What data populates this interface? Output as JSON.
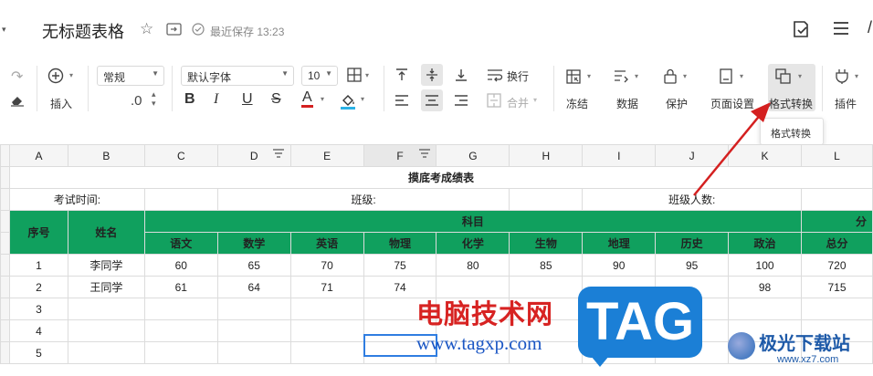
{
  "titlebar": {
    "doc_title": "无标题表格",
    "save_status": "最近保存 13:23"
  },
  "toolbar": {
    "insert_label": "插入",
    "format_style": "常规",
    "decimal_label": ".0",
    "font_name": "默认字体",
    "font_size": "10",
    "wrap_label": "换行",
    "merge_label": "合并",
    "freeze_label": "冻结",
    "data_label": "数据",
    "protect_label": "保护",
    "page_setup_label": "页面设置",
    "format_convert_label": "格式转换",
    "plugin_label": "插件",
    "bold_glyph": "B",
    "italic_glyph": "I",
    "underline_glyph": "U",
    "strike_glyph": "S",
    "fontcolor_glyph": "A"
  },
  "tooltip": "格式转换",
  "sheet": {
    "columns": [
      "A",
      "B",
      "C",
      "D",
      "E",
      "F",
      "G",
      "H",
      "I",
      "J",
      "K",
      "L"
    ],
    "title": "摸底考成绩表",
    "exam_time_label": "考试时间:",
    "class_label": "班级:",
    "class_size_label": "班级人数:",
    "header": {
      "seq": "序号",
      "name": "姓名",
      "subjects": "科目",
      "score_partial": "分",
      "subject_list": [
        "语文",
        "数学",
        "英语",
        "物理",
        "化学",
        "生物",
        "地理",
        "历史",
        "政治",
        "总分"
      ]
    },
    "rows": [
      {
        "seq": "1",
        "name": "李同学",
        "scores": [
          "60",
          "65",
          "70",
          "75",
          "80",
          "85",
          "90",
          "95",
          "100",
          "720"
        ]
      },
      {
        "seq": "2",
        "name": "王同学",
        "scores": [
          "61",
          "64",
          "71",
          "74",
          "",
          "",
          "",
          "",
          "98",
          "715"
        ]
      }
    ],
    "row_numbers": [
      "3",
      "4",
      "5"
    ]
  },
  "watermark": {
    "text": "电脑技术网",
    "url": "www.tagxp.com",
    "tag": "TAG",
    "logo_name": "极光下载站",
    "logo_url": "www.xz7.com"
  },
  "colors": {
    "header_green": "#10a05e",
    "arrow_red": "#d42020",
    "selection_blue": "#2f7de1"
  }
}
